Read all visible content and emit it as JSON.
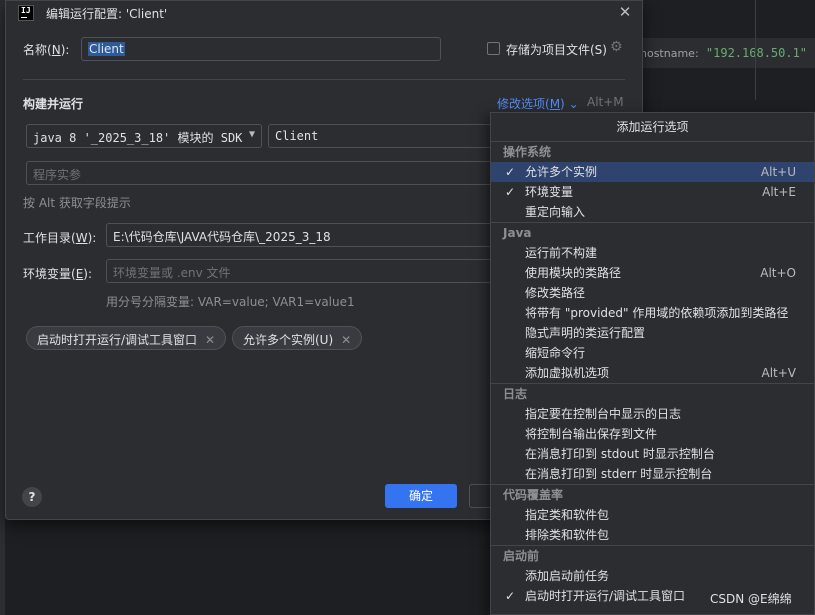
{
  "background": {
    "code_key": "hostname:",
    "code_value": "\"192.168.50.1\""
  },
  "dialog": {
    "app_icon_text": "IJ",
    "title": "编辑运行配置: 'Client'",
    "close_icon": "close-icon",
    "name_label": "名称",
    "name_mnemonic": "N",
    "name_value": "Client",
    "store_as_file_label": "存储为项目文件(S)",
    "store_as_file_checked": false,
    "section_title": "构建并运行",
    "modify_options_label": "修改选项(",
    "modify_options_mnemonic": "M",
    "modify_options_suffix": ")",
    "modify_options_shortcut": "Alt+M",
    "jdk_value": "java 8 '_2025_3_18' 模块的 SDK",
    "main_class_value": "Client",
    "program_args_placeholder": "程序实参",
    "field_hint": "按 Alt 获取字段提示",
    "working_dir_label": "工作目录",
    "working_dir_mnemonic": "W",
    "working_dir_value": "E:\\代码仓库\\JAVA代码仓库\\_2025_3_18",
    "env_label": "环境变量",
    "env_mnemonic": "E",
    "env_placeholder": "环境变量或 .env 文件",
    "env_hint": "用分号分隔变量: VAR=value; VAR1=value1",
    "tags": [
      {
        "label": "启动时打开运行/调试工具窗口"
      },
      {
        "label": "允许多个实例(U)"
      }
    ],
    "help_label": "?",
    "ok_label": "确定"
  },
  "popup": {
    "title": "添加运行选项",
    "sections": [
      {
        "title": "操作系统",
        "items": [
          {
            "label": "允许多个实例",
            "shortcut": "Alt+U",
            "checked": true,
            "selected": true
          },
          {
            "label": "环境变量",
            "shortcut": "Alt+E",
            "checked": true,
            "selected": false
          },
          {
            "label": "重定向输入",
            "shortcut": "",
            "checked": false,
            "selected": false
          }
        ]
      },
      {
        "title": "Java",
        "items": [
          {
            "label": "运行前不构建",
            "shortcut": "",
            "checked": false,
            "selected": false
          },
          {
            "label": "使用模块的类路径",
            "shortcut": "Alt+O",
            "checked": false,
            "selected": false
          },
          {
            "label": "修改类路径",
            "shortcut": "",
            "checked": false,
            "selected": false
          },
          {
            "label": "将带有 \"provided\" 作用域的依赖项添加到类路径",
            "shortcut": "",
            "checked": false,
            "selected": false
          },
          {
            "label": "隐式声明的类运行配置",
            "shortcut": "",
            "checked": false,
            "selected": false
          },
          {
            "label": "缩短命令行",
            "shortcut": "",
            "checked": false,
            "selected": false
          },
          {
            "label": "添加虚拟机选项",
            "shortcut": "Alt+V",
            "checked": false,
            "selected": false
          }
        ]
      },
      {
        "title": "日志",
        "items": [
          {
            "label": "指定要在控制台中显示的日志",
            "shortcut": "",
            "checked": false,
            "selected": false
          },
          {
            "label": "将控制台输出保存到文件",
            "shortcut": "",
            "checked": false,
            "selected": false
          },
          {
            "label": "在消息打印到 stdout 时显示控制台",
            "shortcut": "",
            "checked": false,
            "selected": false
          },
          {
            "label": "在消息打印到 stderr 时显示控制台",
            "shortcut": "",
            "checked": false,
            "selected": false
          }
        ]
      },
      {
        "title": "代码覆盖率",
        "items": [
          {
            "label": "指定类和软件包",
            "shortcut": "",
            "checked": false,
            "selected": false
          },
          {
            "label": "排除类和软件包",
            "shortcut": "",
            "checked": false,
            "selected": false
          }
        ]
      },
      {
        "title": "启动前",
        "items": [
          {
            "label": "添加启动前任务",
            "shortcut": "",
            "checked": false,
            "selected": false
          },
          {
            "label": "启动时打开运行/调试工具窗口",
            "shortcut": "",
            "checked": true,
            "selected": false
          }
        ]
      }
    ]
  },
  "watermark": "CSDN @E绵绵"
}
